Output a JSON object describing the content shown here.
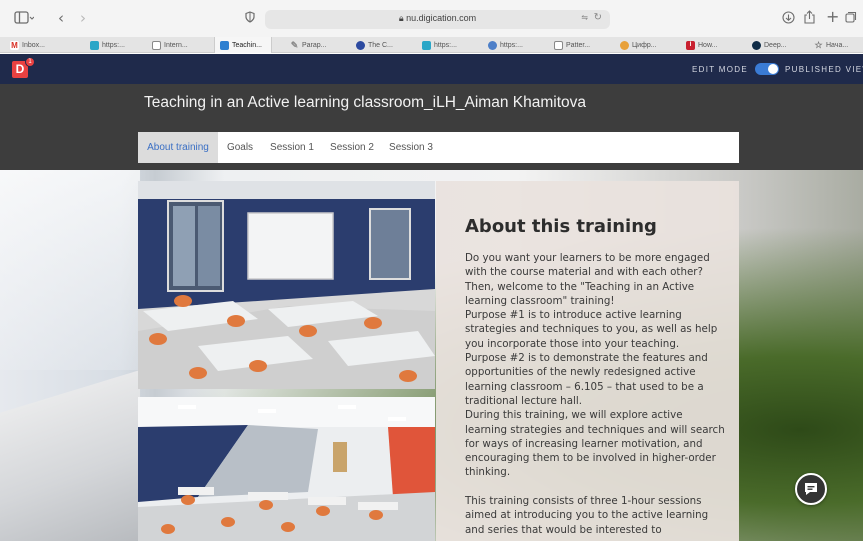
{
  "browser": {
    "url": "nu.digication.com",
    "tabs": [
      {
        "label": "Inbox...",
        "icon": "gmail-icon",
        "color": "#d93025"
      },
      {
        "label": "https:...",
        "icon": "site-icon",
        "color": "#2aa6c7"
      },
      {
        "label": "Intern...",
        "icon": "page-icon",
        "color": "#888888"
      },
      {
        "label": "Teachin...",
        "icon": "digication-icon",
        "color": "#2d7fd0",
        "active": true
      },
      {
        "label": "Parap...",
        "icon": "quill-icon",
        "color": "#8a8a8a"
      },
      {
        "label": "The C...",
        "icon": "globe-icon",
        "color": "#2c4aa0"
      },
      {
        "label": "https:...",
        "icon": "site-icon",
        "color": "#2aa6c7"
      },
      {
        "label": "https:...",
        "icon": "globe-icon",
        "color": "#4d7fc8"
      },
      {
        "label": "Patter...",
        "icon": "page-icon",
        "color": "#888888"
      },
      {
        "label": "Цифр...",
        "icon": "orb-icon",
        "color": "#e8a13a"
      },
      {
        "label": "How...",
        "icon": "how-icon",
        "color": "#c8202f"
      },
      {
        "label": "Deep...",
        "icon": "deepl-icon",
        "color": "#0f2b46"
      },
      {
        "label": "Нача...",
        "icon": "star-icon",
        "color": "#777777"
      }
    ]
  },
  "topbar": {
    "logo": "D",
    "badge": "1",
    "edit_mode": "EDIT MODE",
    "published_view": "PUBLISHED VIEW"
  },
  "page": {
    "title": "Teaching in an Active learning classroom_iLH_Aiman Khamitova",
    "nav": [
      "About training",
      "Goals",
      "Session 1",
      "Session 2",
      "Session 3"
    ],
    "active_nav": "About training"
  },
  "about": {
    "heading": "About this training",
    "paragraphs": [
      "Do you want your learners to be more engaged with the course material and with each other? Then, welcome to the \"Teaching in an Active learning classroom\" training!",
      "Purpose #1 is to introduce active learning strategies and techniques to you, as well as help you incorporate those into your teaching.",
      "Purpose #2 is to demonstrate the features and opportunities of the newly redesigned active learning classroom – 6.105 – that used to be a traditional lecture hall.",
      "During this training, we will explore active learning strategies and techniques and will search for ways of increasing learner motivation, and encouraging them to be involved in higher-order thinking.",
      "",
      "This training consists of three 1-hour sessions aimed at introducing you to the active learning and series that would be interested to"
    ]
  },
  "colors": {
    "topbar": "#1f2a4b",
    "header": "#3d3d3d",
    "accent": "#3a6fc4",
    "logo": "#e94141"
  }
}
